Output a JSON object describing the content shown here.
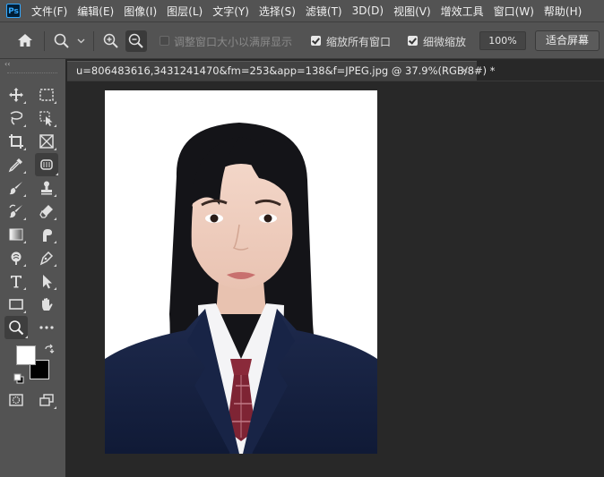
{
  "menubar": {
    "logo": "Ps",
    "items": [
      "文件(F)",
      "编辑(E)",
      "图像(I)",
      "图层(L)",
      "文字(Y)",
      "选择(S)",
      "滤镜(T)",
      "3D(D)",
      "视图(V)",
      "增效工具",
      "窗口(W)",
      "帮助(H)"
    ]
  },
  "options": {
    "resize_windows_label": "调整窗口大小以满屏显示",
    "zoom_all_windows_label": "缩放所有窗口",
    "scrubby_zoom_label": "细微缩放",
    "zoom_value": "100%",
    "fit_screen_label": "适合屏幕",
    "resize_windows_checked": false,
    "zoom_all_windows_checked": true,
    "scrubby_zoom_checked": true
  },
  "toolbox": {
    "collapse_label": "‹‹",
    "foreground_color": "#ffffff",
    "background_color": "#000000",
    "tools": [
      {
        "name": "move-tool-icon"
      },
      {
        "name": "marquee-tool-icon"
      },
      {
        "name": "lasso-tool-icon"
      },
      {
        "name": "object-selection-tool-icon"
      },
      {
        "name": "crop-tool-icon"
      },
      {
        "name": "frame-tool-icon"
      },
      {
        "name": "eyedropper-tool-icon"
      },
      {
        "name": "healing-brush-tool-icon"
      },
      {
        "name": "brush-tool-icon"
      },
      {
        "name": "clone-stamp-tool-icon"
      },
      {
        "name": "history-brush-tool-icon"
      },
      {
        "name": "eraser-tool-icon"
      },
      {
        "name": "gradient-tool-icon"
      },
      {
        "name": "smudge-tool-icon"
      },
      {
        "name": "dodge-tool-icon"
      },
      {
        "name": "pen-tool-icon"
      },
      {
        "name": "type-tool-icon"
      },
      {
        "name": "path-selection-tool-icon"
      },
      {
        "name": "rectangle-tool-icon"
      },
      {
        "name": "hand-tool-icon"
      },
      {
        "name": "zoom-tool-icon"
      },
      {
        "name": "more-tools-icon"
      }
    ]
  },
  "document": {
    "tab_title": "u=806483616,3431241470&fm=253&app=138&f=JPEG.jpg @ 37.9%(RGB/8#) *",
    "close_glyph": "×"
  },
  "colors": {
    "ui_panel": "#535353",
    "workspace": "#282828",
    "tab": "#424242",
    "accent_ps": "#31a8ff"
  }
}
